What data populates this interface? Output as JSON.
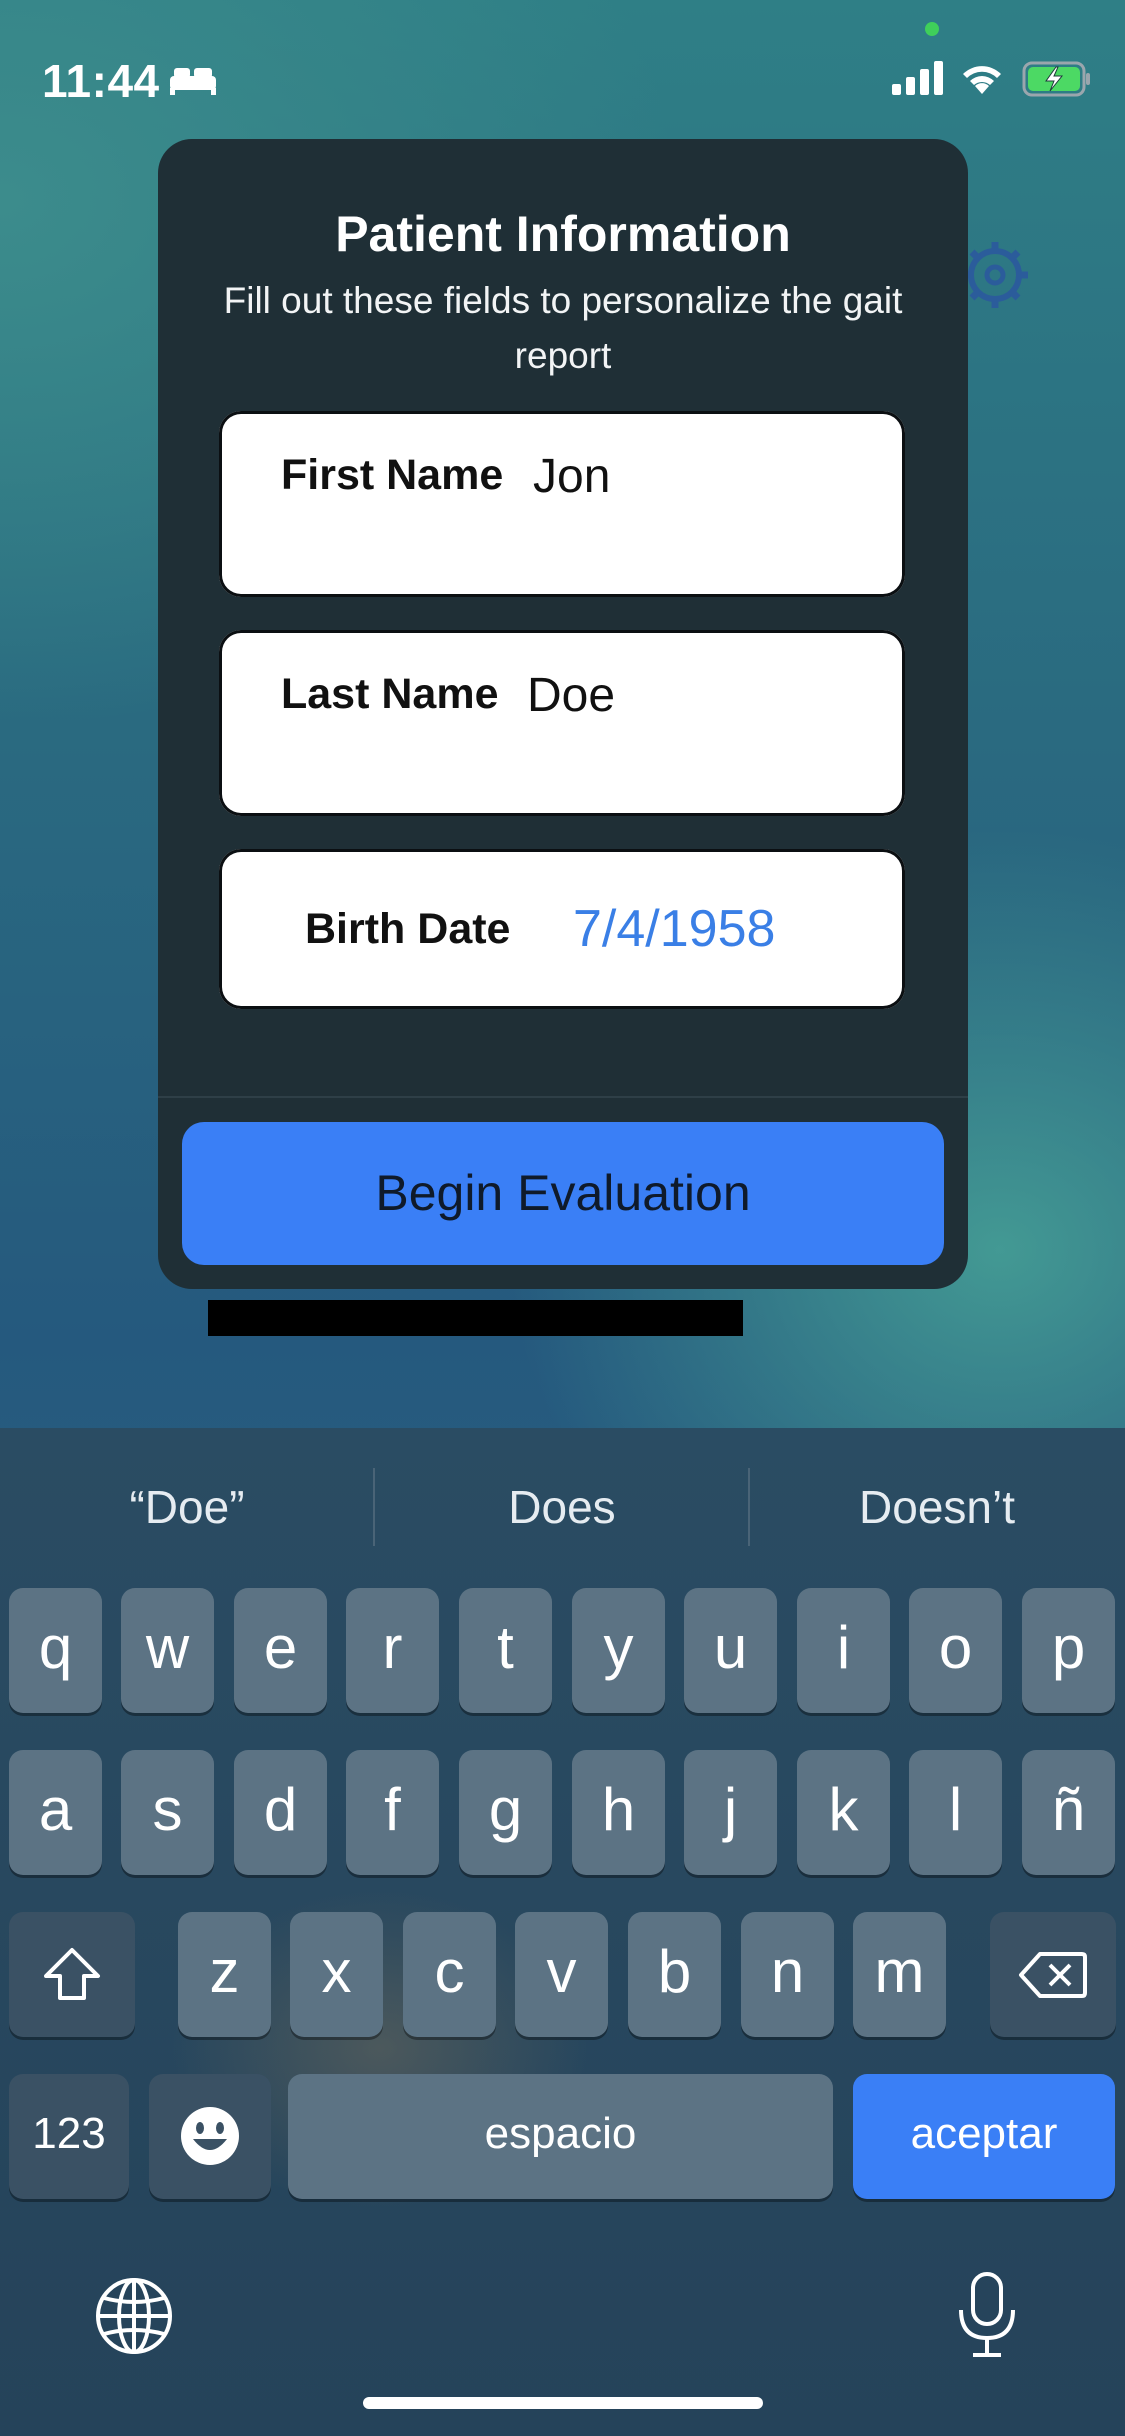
{
  "status_bar": {
    "time": "11:44"
  },
  "dialog": {
    "title": "Patient Information",
    "subtitle": "Fill out these fields to personalize the gait report",
    "fields": [
      {
        "label": "First Name",
        "value": "Jon"
      },
      {
        "label": "Last Name",
        "value": "Doe"
      },
      {
        "label": "Birth Date",
        "value": "7/4/1958"
      }
    ],
    "primary_button": "Begin Evaluation"
  },
  "keyboard": {
    "suggestions": [
      "“Doe”",
      "Does",
      "Doesn’t"
    ],
    "row1": [
      "q",
      "w",
      "e",
      "r",
      "t",
      "y",
      "u",
      "i",
      "o",
      "p"
    ],
    "row2": [
      "a",
      "s",
      "d",
      "f",
      "g",
      "h",
      "j",
      "k",
      "l",
      "ñ"
    ],
    "row3": [
      "z",
      "x",
      "c",
      "v",
      "b",
      "n",
      "m"
    ],
    "numbers_key": "123",
    "space_key": "espacio",
    "return_key": "aceptar",
    "icons": [
      "shift-icon",
      "delete-icon",
      "emoji-icon",
      "globe-icon",
      "microphone-icon"
    ]
  }
}
